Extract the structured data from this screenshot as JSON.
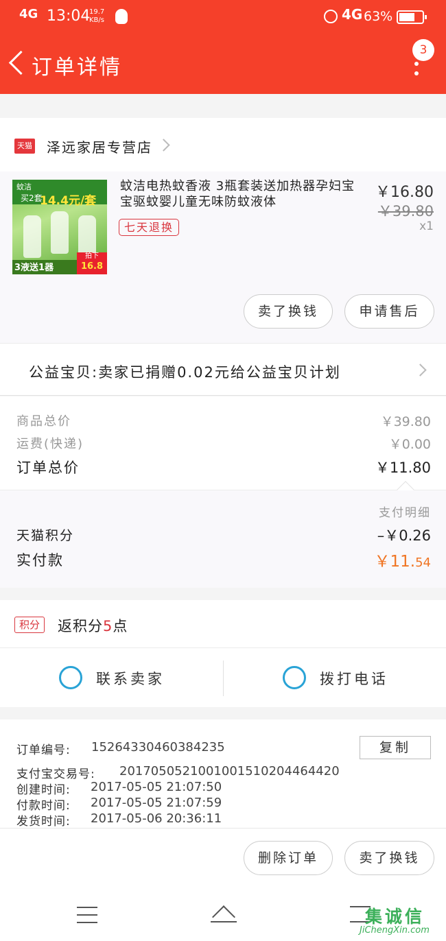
{
  "status_bar": {
    "network": "4G",
    "time": "13:04",
    "speed_value": "19.7",
    "speed_unit": "KB/s",
    "network_right": "4G",
    "battery": "63%"
  },
  "header": {
    "title": "订单详情",
    "badge_count": "3"
  },
  "shop": {
    "icon_label": "天猫",
    "name": "泽远家居专营店"
  },
  "product": {
    "title": "蚊洁电热蚊香液 3瓶套装送加热器孕妇宝宝驱蚊婴儿童无味防蚊液体",
    "tag": "七天退换",
    "price": "￥16.80",
    "original_price": "￥39.80",
    "quantity": "x1",
    "image_text": {
      "brand": "蚊洁",
      "offer": "买2套",
      "offer_price": "14.4元/套",
      "promo": "3液送1器",
      "badge_top": "拍下",
      "badge_price": "16.8"
    },
    "actions": [
      "卖了换钱",
      "申请售后"
    ]
  },
  "charity": {
    "text": "公益宝贝:卖家已捐赠0.02元给公益宝贝计划"
  },
  "price_summary": {
    "items_total_label": "商品总价",
    "items_total_value": "￥39.80",
    "shipping_label": "运费(快递)",
    "shipping_value": "￥0.00",
    "order_total_label": "订单总价",
    "order_total_value": "￥11.80"
  },
  "payment": {
    "detail_link": "支付明细",
    "points_label": "天猫积分",
    "points_value": "–￥0.26",
    "paid_label": "实付款",
    "paid_currency": "￥",
    "paid_int": "11.",
    "paid_dec": "54",
    "paid_color": "#f07524"
  },
  "points": {
    "icon_label": "积分",
    "text_before": "返积分",
    "amount": "5",
    "text_after": "点"
  },
  "contact": {
    "seller_label": "联系卖家",
    "phone_label": "拨打电话",
    "icon_color": "#29a3d6"
  },
  "order_info": {
    "order_no_label": "订单编号:",
    "order_no": "15264330460384235",
    "copy_label": "复制",
    "alipay_label": "支付宝交易号:",
    "alipay_no": "2017050521001001510204464420",
    "created_label": "创建时间:",
    "created": "2017-05-05 21:07:50",
    "paid_label": "付款时间:",
    "paid": "2017-05-05 21:07:59",
    "shipped_label": "发货时间:",
    "shipped": "2017-05-06 20:36:11"
  },
  "bottom_actions": [
    "删除订单",
    "卖了换钱"
  ],
  "watermark": {
    "logo": "集诚信",
    "text": "JiChengXin.com"
  },
  "colors": {
    "brand": "#f5402a",
    "accent_red": "#d9363e"
  }
}
